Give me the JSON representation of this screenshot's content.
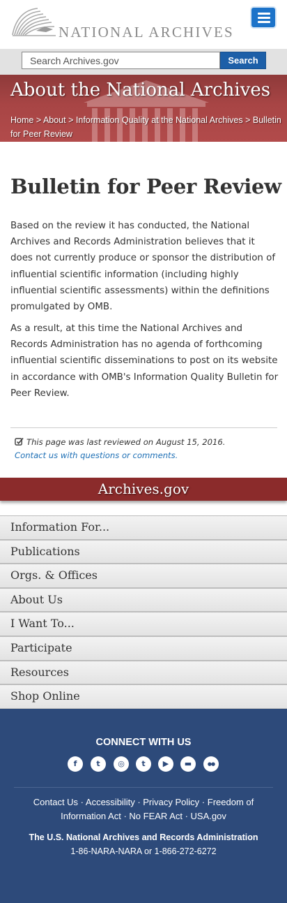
{
  "header": {
    "logo_text": "NATIONAL ARCHIVES",
    "menu_icon": "hamburger-icon"
  },
  "search": {
    "placeholder": "Search Archives.gov",
    "button_label": "Search"
  },
  "banner": {
    "title": "About the National Archives",
    "breadcrumb": {
      "home": "Home",
      "about": "About",
      "info_quality": "Information Quality at the National Archives",
      "current": "Bulletin for Peer Review",
      "separator": ">"
    }
  },
  "main": {
    "title": "Bulletin for Peer Review",
    "paragraphs": [
      "Based on the review it has conducted, the National Archives and Records Administration believes that it does not currently produce or sponsor the distribution of influential scientific information (including highly influential scientific assessments) within the definitions promulgated by OMB.",
      "As a result, at this time the National Archives and Records Administration has no agenda of forthcoming influential scientific disseminations to post on its website in accordance with OMB's Information Quality Bulletin for Peer Review."
    ],
    "last_reviewed": "This page was last reviewed on August 15, 2016.",
    "contact_link": "Contact us with questions or comments."
  },
  "footer_nav": {
    "site_name": "Archives.gov",
    "items": [
      "Information For...",
      "Publications",
      "Orgs. & Offices",
      "About Us",
      "I Want To...",
      "Participate",
      "Resources",
      "Shop Online"
    ]
  },
  "footer": {
    "connect_heading": "CONNECT WITH US",
    "social": [
      {
        "name": "facebook-icon",
        "glyph": "f"
      },
      {
        "name": "twitter-icon",
        "glyph": "t"
      },
      {
        "name": "instagram-icon",
        "glyph": "◎"
      },
      {
        "name": "tumblr-icon",
        "glyph": "t"
      },
      {
        "name": "youtube-icon",
        "glyph": "▶"
      },
      {
        "name": "blog-icon",
        "glyph": "▬"
      },
      {
        "name": "flickr-icon",
        "glyph": "●●"
      }
    ],
    "links": {
      "contact": "Contact Us",
      "accessibility": "Accessibility",
      "privacy": "Privacy Policy",
      "foia": "Freedom of Information Act",
      "nofear": "No FEAR Act",
      "usagov": "USA.gov",
      "separator": " · "
    },
    "org_name": "The U.S. National Archives and Records Administration",
    "phone": "1-86-NARA-NARA or 1-866-272-6272"
  },
  "colors": {
    "menu_button": "#1c73c9",
    "search_button": "#1d5fa8",
    "banner": "#a84545",
    "archives_bar": "#8b2b2b",
    "link": "#1d6fb5",
    "footer": "#2d4a7a"
  }
}
